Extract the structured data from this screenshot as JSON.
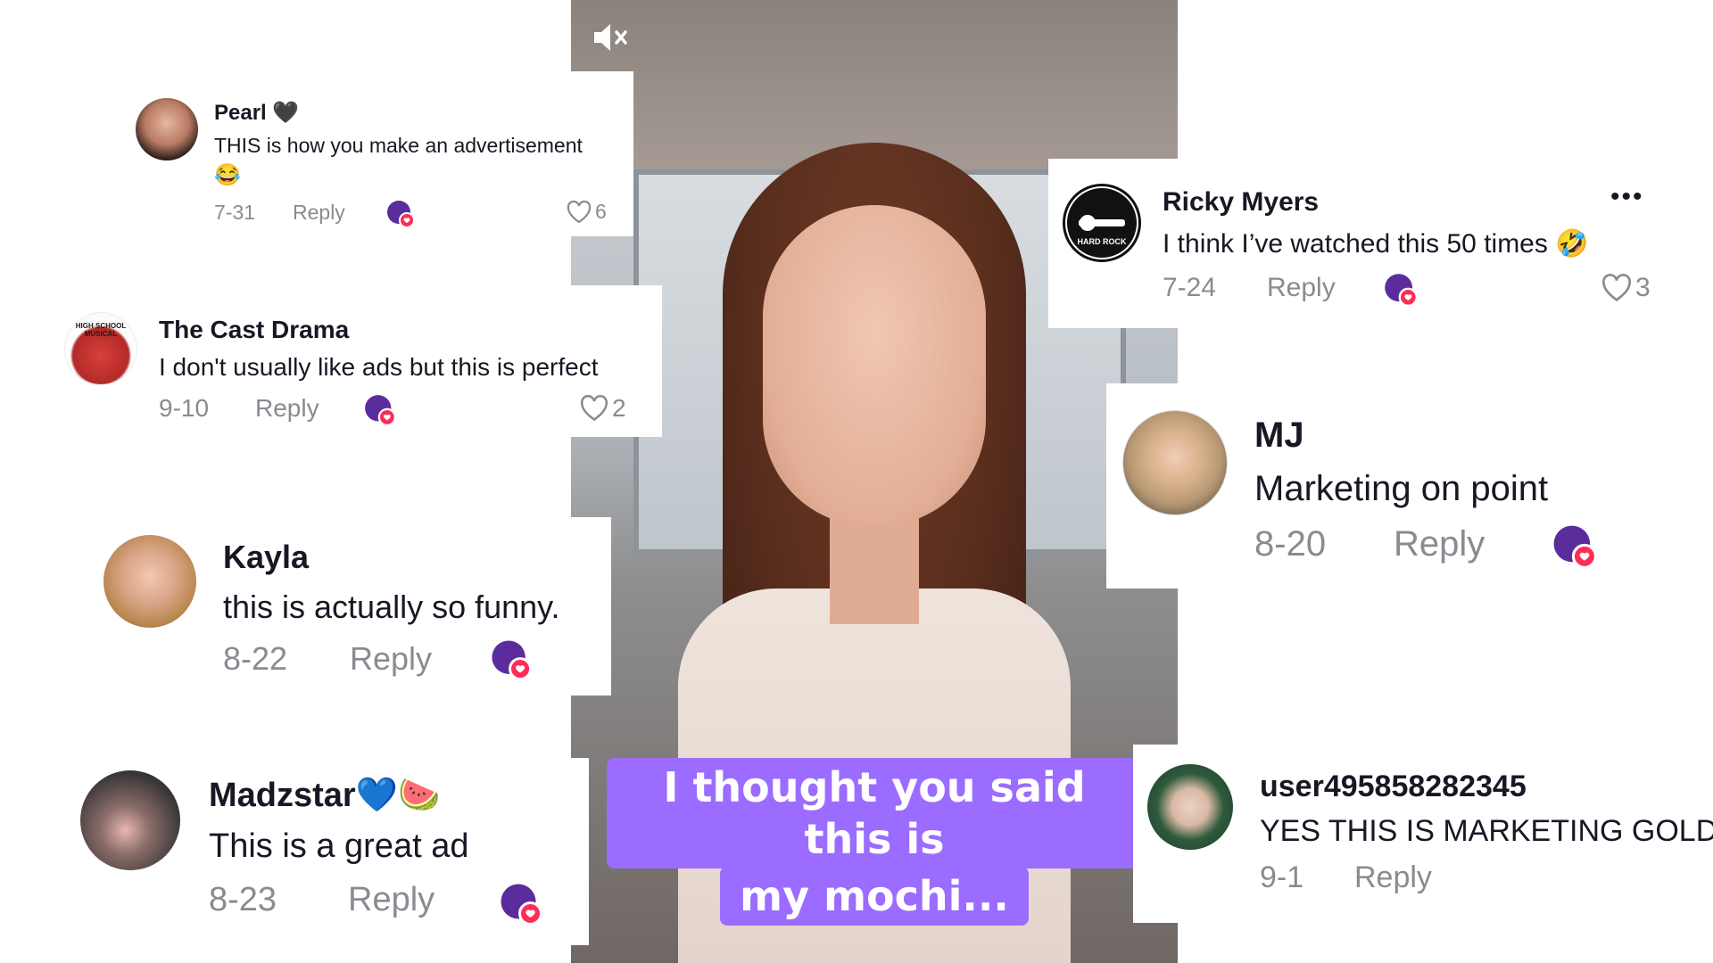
{
  "video": {
    "caption_line1": "I thought you said this is",
    "caption_line2": "my mochi...",
    "mute_icon": "speaker-muted-icon"
  },
  "colors": {
    "caption_bg": "#9b6cff",
    "meta_gray": "#8a8b91",
    "mochi_purple": "#5b2d9c",
    "heart_red": "#ff2c55"
  },
  "comments": [
    {
      "user": "Pearl",
      "name_emoji": "🖤",
      "text": "THIS is how you make an advertisement",
      "text_emoji": "😂",
      "date": "7-31",
      "reply": "Reply",
      "likes": "6"
    },
    {
      "user": "The Cast Drama",
      "text": "I don't usually like ads but this is perfect",
      "date": "9-10",
      "reply": "Reply",
      "likes": "2"
    },
    {
      "user": "Kayla",
      "text": "this is actually so funny.",
      "date": "8-22",
      "reply": "Reply"
    },
    {
      "user": "Madzstar",
      "name_emoji": "💙🍉",
      "text": "This is a great ad",
      "date": "8-23",
      "reply": "Reply"
    },
    {
      "user": "Ricky Myers",
      "text": "I think I’ve watched this 50 times",
      "text_emoji": "🤣",
      "date": "7-24",
      "reply": "Reply",
      "likes": "3",
      "more": "•••"
    },
    {
      "user": "MJ",
      "text": "Marketing on point",
      "date": "8-20",
      "reply": "Reply"
    },
    {
      "user": "user495858282345",
      "text": "YES THIS IS MARKETING GOLD",
      "date": "9-1",
      "reply": "Reply"
    }
  ],
  "avatar_texts": {
    "cast_drama": "HIGH SCHOOL MUSICAL",
    "ricky": "HARD ROCK"
  },
  "mochi_badge": "my mochi"
}
